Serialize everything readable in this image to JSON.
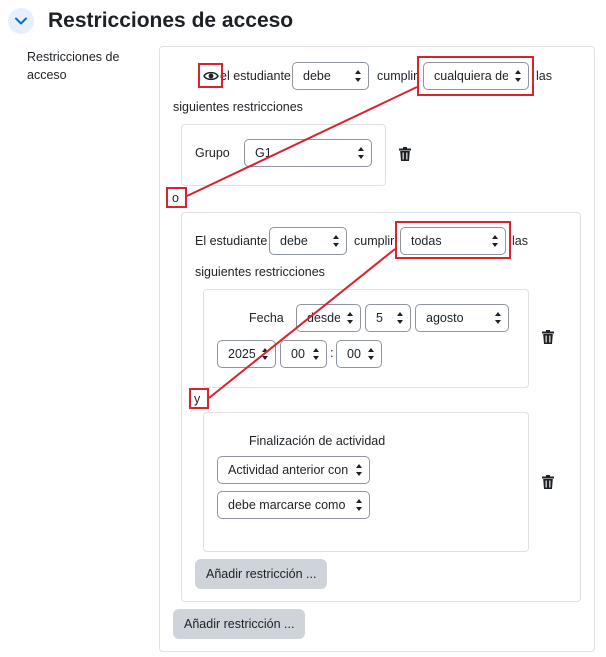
{
  "section": {
    "title": "Restricciones de acceso",
    "field_label": "Restricciones de acceso"
  },
  "outer_rule": {
    "prefix": "el estudiante",
    "must_value": "debe",
    "meet_label": "cumplir",
    "scope_value": "cualquiera de",
    "suffix_1": "las",
    "suffix_2": "siguientes restricciones",
    "group_condition": {
      "label": "Grupo",
      "value": "G1"
    },
    "connector": "o",
    "add_button": "Añadir restricción ..."
  },
  "inner_rule": {
    "prefix": "El estudiante",
    "must_value": "debe",
    "meet_label": "cumplir",
    "scope_value": "todas",
    "suffix_1": "las",
    "suffix_2": "siguientes restricciones",
    "connector": "y",
    "date_condition": {
      "label": "Fecha",
      "direction_value": "desde",
      "day_value": "5",
      "month_value": "agosto",
      "year_value": "2025",
      "hour_value": "00",
      "minute_value": "00",
      "time_separator": ":"
    },
    "completion_condition": {
      "label": "Finalización de actividad",
      "activity_value": "Actividad anterior con",
      "state_value": "debe marcarse como c"
    },
    "add_button": "Añadir restricción ..."
  },
  "colors": {
    "highlight": "#d9232e",
    "button_bg": "#ced4da",
    "toggle_bg": "#e7effb",
    "link_blue": "#0f6cbf"
  },
  "icons": [
    "chevron-down-icon",
    "eye-icon",
    "trash-icon",
    "select-caret-icon"
  ]
}
